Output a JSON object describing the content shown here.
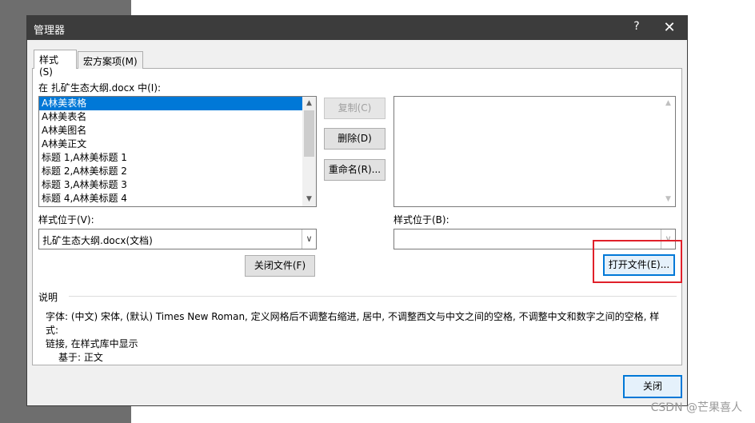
{
  "dialog": {
    "title": "管理器",
    "help_label": "?",
    "close_glyph": "✕"
  },
  "tabs": [
    {
      "label": "样式(S)",
      "active": true
    },
    {
      "label": "宏方案项(M)",
      "active": false
    }
  ],
  "left": {
    "header": "在 扎矿生态大纲.docx 中(I):",
    "items": [
      "A林美表格",
      "A林美表名",
      "A林美图名",
      "A林美正文",
      "标题 1,A林美标题 1",
      "标题 2,A林美标题 2",
      "标题 3,A林美标题 3",
      "标题 4,A林美标题 4"
    ],
    "selected_index": 0,
    "location_label": "样式位于(V):",
    "location_value": "扎矿生态大纲.docx(文档)",
    "close_file_button": "关闭文件(F)"
  },
  "middle": {
    "copy_button": "复制(C)",
    "delete_button": "删除(D)",
    "rename_button": "重命名(R)..."
  },
  "right": {
    "location_label": "样式位于(B):",
    "location_value": "",
    "open_file_button": "打开文件(E)..."
  },
  "description": {
    "label": "说明",
    "line1": "字体: (中文) 宋体, (默认) Times New Roman, 定义网格后不调整右缩进, 居中, 不调整西文与中文之间的空格, 不调整中文和数字之间的空格, 样式:",
    "line2": "链接, 在样式库中显示",
    "line3": "基于: 正文"
  },
  "footer": {
    "close_button": "关闭"
  },
  "watermark": "CSDN @芒果喜人",
  "colors": {
    "titlebar": "#3c3c3c",
    "selection": "#0078d7",
    "highlight_box": "#e0202a"
  }
}
